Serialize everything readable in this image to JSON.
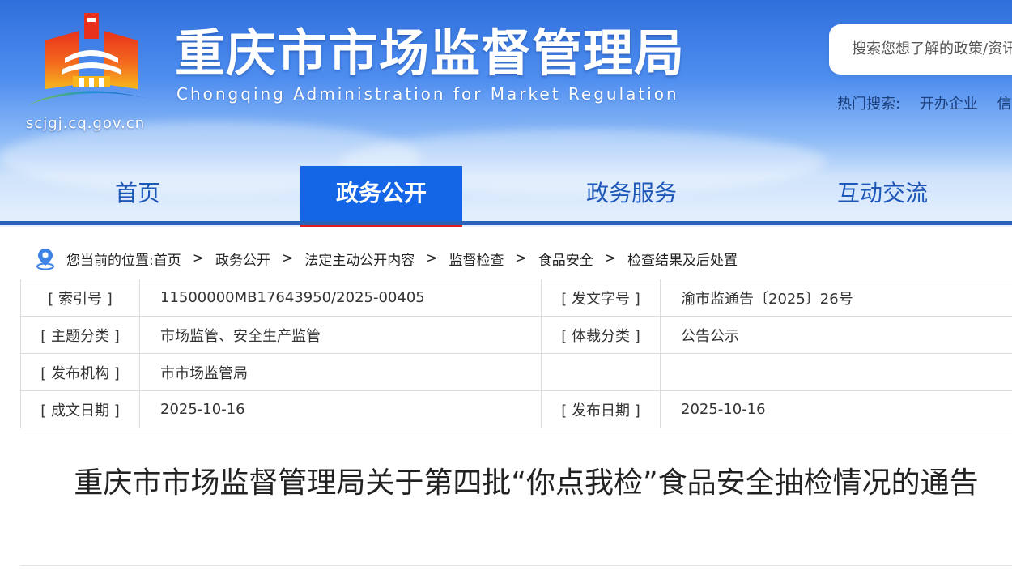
{
  "header": {
    "title": "重庆市市场监督管理局",
    "subtitle": "Chongqing  Administration for Market Regulation",
    "domain": "scjgj.cq.gov.cn",
    "search_placeholder": "搜索您想了解的政策/资讯",
    "hot_search_label": "热门搜索:",
    "hot_search_items": [
      "开办企业",
      "信用"
    ]
  },
  "nav": {
    "items": [
      "首页",
      "政务公开",
      "政务服务",
      "互动交流"
    ],
    "active_index": 1
  },
  "breadcrumb": {
    "prefix": "您当前的位置:",
    "items": [
      "首页",
      "政务公开",
      "法定主动公开内容",
      "监督检查",
      "食品安全",
      "检查结果及后处置"
    ],
    "separator": ">"
  },
  "info_table": {
    "rows": [
      {
        "label1": "[ 索引号 ]",
        "value1": "11500000MB17643950/2025-00405",
        "label2": "[ 发文字号 ]",
        "value2": "渝市监通告〔2025〕26号"
      },
      {
        "label1": "[ 主题分类 ]",
        "value1": "市场监管、安全生产监管",
        "label2": "[ 体裁分类 ]",
        "value2": "公告公示"
      },
      {
        "label1": "[ 发布机构 ]",
        "value1": "市市场监管局",
        "label2": "",
        "value2": ""
      },
      {
        "label1": "[ 成文日期 ]",
        "value1": "2025-10-16",
        "label2": "[ 发布日期 ]",
        "value2": "2025-10-16"
      }
    ]
  },
  "article": {
    "title": "重庆市市场监督管理局关于第四批“你点我检”食品安全抽检情况的通告"
  },
  "colors": {
    "nav_active_bg": "#1466e6",
    "nav_active_underline": "#e21c1c",
    "nav_text": "#1d57b8",
    "header_top": "#2f6fdb"
  }
}
